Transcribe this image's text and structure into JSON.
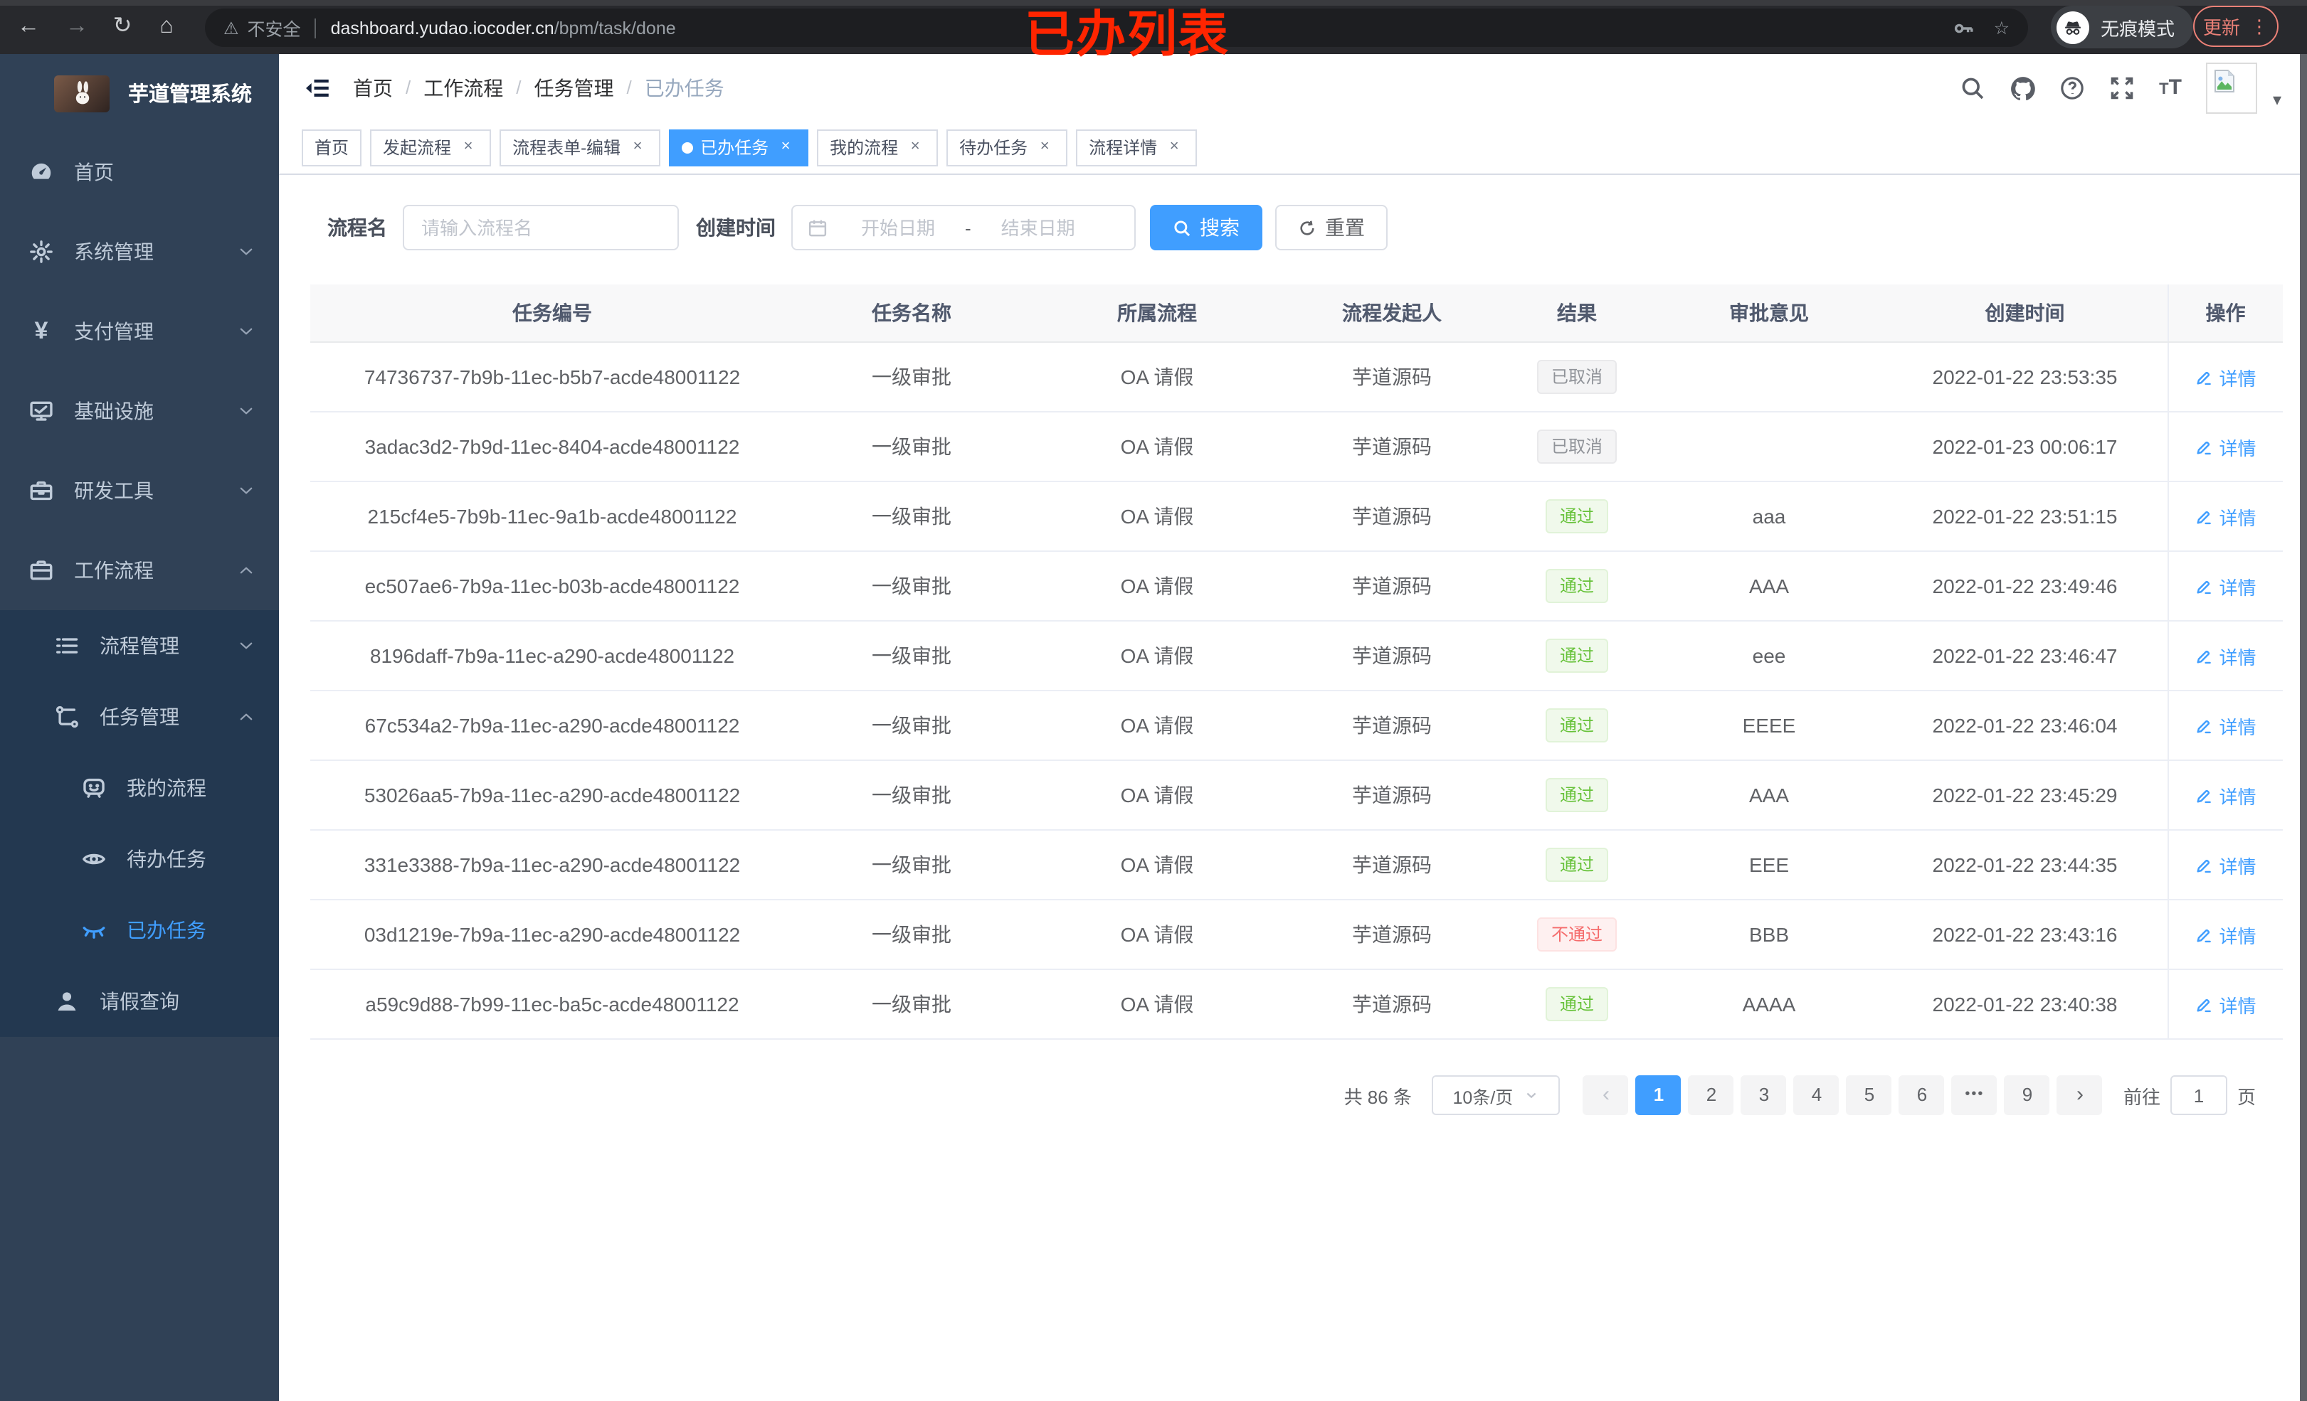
{
  "browser": {
    "security_label": "不安全",
    "url_host": "dashboard.yudao.iocoder.cn",
    "url_path": "/bpm/task/done",
    "incognito_label": "无痕模式",
    "update_label": "更新"
  },
  "annotation": "已办列表",
  "colors": {
    "accent": "#409eff",
    "success": "#67c23a",
    "danger": "#f56c6c",
    "info": "#909399",
    "annotation_red": "#ff2500",
    "chrome_update": "#ec8177",
    "sidebar_bg": "#304156",
    "sidebar_submenu_bg": "#233850"
  },
  "sidebar": {
    "title": "芋道管理系统",
    "menu": [
      {
        "label": "首页",
        "icon": "dashboard-icon",
        "level": 1
      },
      {
        "label": "系统管理",
        "icon": "gear-icon",
        "level": 1,
        "chevron": "down"
      },
      {
        "label": "支付管理",
        "icon": "yen-icon",
        "level": 1,
        "chevron": "down"
      },
      {
        "label": "基础设施",
        "icon": "monitor-icon",
        "level": 1,
        "chevron": "down"
      },
      {
        "label": "研发工具",
        "icon": "toolbox-icon",
        "level": 1,
        "chevron": "down"
      },
      {
        "label": "工作流程",
        "icon": "briefcase-icon",
        "level": 1,
        "chevron": "up"
      },
      {
        "label": "流程管理",
        "icon": "list-icon",
        "level": 2,
        "chevron": "down",
        "in_expanded": true
      },
      {
        "label": "任务管理",
        "icon": "tree-icon",
        "level": 2,
        "chevron": "up",
        "in_expanded": true
      },
      {
        "label": "我的流程",
        "icon": "chat-face-icon",
        "level": 3,
        "in_expanded": true
      },
      {
        "label": "待办任务",
        "icon": "eye-open-icon",
        "level": 3,
        "in_expanded": true
      },
      {
        "label": "已办任务",
        "icon": "eye-closed-icon",
        "level": 3,
        "in_expanded": true,
        "active": true
      },
      {
        "label": "请假查询",
        "icon": "user-icon",
        "level": 2,
        "in_expanded": true
      }
    ]
  },
  "breadcrumb": [
    "首页",
    "工作流程",
    "任务管理",
    "已办任务"
  ],
  "tabs": [
    {
      "label": "首页",
      "closable": false
    },
    {
      "label": "发起流程",
      "closable": true
    },
    {
      "label": "流程表单-编辑",
      "closable": true
    },
    {
      "label": "已办任务",
      "closable": true,
      "active": true
    },
    {
      "label": "我的流程",
      "closable": true
    },
    {
      "label": "待办任务",
      "closable": true
    },
    {
      "label": "流程详情",
      "closable": true
    }
  ],
  "filters": {
    "name_label": "流程名",
    "name_placeholder": "请输入流程名",
    "time_label": "创建时间",
    "start_placeholder": "开始日期",
    "range_separator": "-",
    "end_placeholder": "结束日期",
    "search_label": "搜索",
    "reset_label": "重置"
  },
  "table": {
    "headers": [
      "任务编号",
      "任务名称",
      "所属流程",
      "流程发起人",
      "结果",
      "审批意见",
      "创建时间",
      "操作"
    ],
    "detail_label": "详情",
    "rows": [
      {
        "id": "74736737-7b9b-11ec-b5b7-acde48001122",
        "name": "一级审批",
        "flow": "OA 请假",
        "starter": "芋道源码",
        "result": "已取消",
        "result_type": "cancel",
        "opinion": "",
        "time": "2022-01-22 23:53:35"
      },
      {
        "id": "3adac3d2-7b9d-11ec-8404-acde48001122",
        "name": "一级审批",
        "flow": "OA 请假",
        "starter": "芋道源码",
        "result": "已取消",
        "result_type": "cancel",
        "opinion": "",
        "time": "2022-01-23 00:06:17"
      },
      {
        "id": "215cf4e5-7b9b-11ec-9a1b-acde48001122",
        "name": "一级审批",
        "flow": "OA 请假",
        "starter": "芋道源码",
        "result": "通过",
        "result_type": "pass",
        "opinion": "aaa",
        "time": "2022-01-22 23:51:15"
      },
      {
        "id": "ec507ae6-7b9a-11ec-b03b-acde48001122",
        "name": "一级审批",
        "flow": "OA 请假",
        "starter": "芋道源码",
        "result": "通过",
        "result_type": "pass",
        "opinion": "AAA",
        "time": "2022-01-22 23:49:46"
      },
      {
        "id": "8196daff-7b9a-11ec-a290-acde48001122",
        "name": "一级审批",
        "flow": "OA 请假",
        "starter": "芋道源码",
        "result": "通过",
        "result_type": "pass",
        "opinion": "eee",
        "time": "2022-01-22 23:46:47"
      },
      {
        "id": "67c534a2-7b9a-11ec-a290-acde48001122",
        "name": "一级审批",
        "flow": "OA 请假",
        "starter": "芋道源码",
        "result": "通过",
        "result_type": "pass",
        "opinion": "EEEE",
        "time": "2022-01-22 23:46:04"
      },
      {
        "id": "53026aa5-7b9a-11ec-a290-acde48001122",
        "name": "一级审批",
        "flow": "OA 请假",
        "starter": "芋道源码",
        "result": "通过",
        "result_type": "pass",
        "opinion": "AAA",
        "time": "2022-01-22 23:45:29"
      },
      {
        "id": "331e3388-7b9a-11ec-a290-acde48001122",
        "name": "一级审批",
        "flow": "OA 请假",
        "starter": "芋道源码",
        "result": "通过",
        "result_type": "pass",
        "opinion": "EEE",
        "time": "2022-01-22 23:44:35"
      },
      {
        "id": "03d1219e-7b9a-11ec-a290-acde48001122",
        "name": "一级审批",
        "flow": "OA 请假",
        "starter": "芋道源码",
        "result": "不通过",
        "result_type": "reject",
        "opinion": "BBB",
        "time": "2022-01-22 23:43:16"
      },
      {
        "id": "a59c9d88-7b99-11ec-ba5c-acde48001122",
        "name": "一级审批",
        "flow": "OA 请假",
        "starter": "芋道源码",
        "result": "通过",
        "result_type": "pass",
        "opinion": "AAAA",
        "time": "2022-01-22 23:40:38"
      }
    ]
  },
  "pagination": {
    "total": "共 86 条",
    "page_size": "10条/页",
    "pages": [
      "1",
      "2",
      "3",
      "4",
      "5",
      "6",
      "•••",
      "9"
    ],
    "active_page": "1",
    "goto_label": "前往",
    "goto_value": "1",
    "unit_label": "页"
  }
}
